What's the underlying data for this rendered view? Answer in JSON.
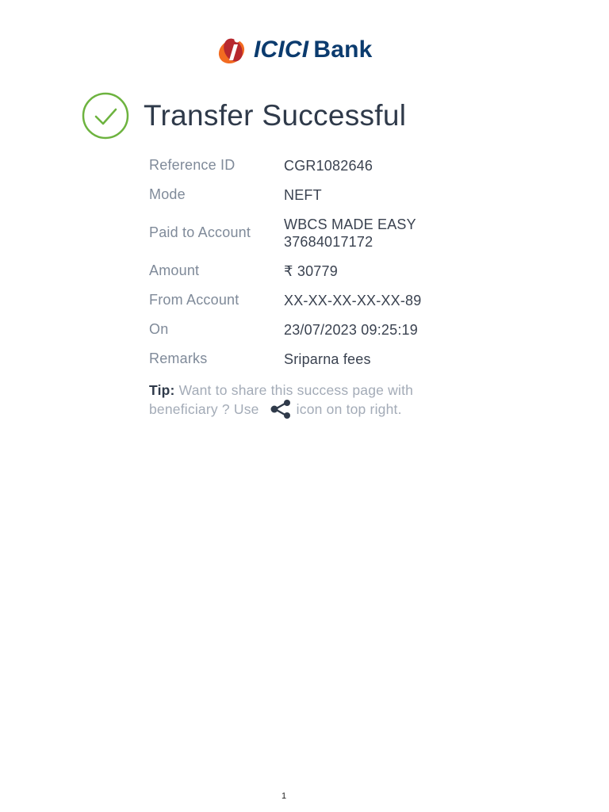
{
  "header": {
    "logo_brand": "ICICI",
    "logo_bank": "Bank"
  },
  "status": {
    "title": "Transfer Successful",
    "icon": "check-circle-icon",
    "success_color": "#6db33f"
  },
  "details": [
    {
      "label": "Reference ID",
      "value": [
        "CGR1082646"
      ]
    },
    {
      "label": "Mode",
      "value": [
        "NEFT"
      ]
    },
    {
      "label": "Paid to Account",
      "value": [
        "WBCS MADE EASY",
        "37684017172"
      ]
    },
    {
      "label": "Amount",
      "value": [
        "₹ 30779"
      ]
    },
    {
      "label": "From Account",
      "value": [
        "XX-XX-XX-XX-XX-89"
      ]
    },
    {
      "label": "On",
      "value": [
        "23/07/2023 09:25:19"
      ]
    },
    {
      "label": "Remarks",
      "value": [
        "Sriparna fees"
      ]
    }
  ],
  "tip": {
    "label": "Tip:",
    "text_before": " Want to share this success page with beneficiary ? Use",
    "icon": "share-icon",
    "text_after": "icon on top right."
  },
  "footer": {
    "page_number": "1"
  },
  "colors": {
    "brand_orange": "#f26b21",
    "brand_red": "#b7282e",
    "brand_navy": "#0b3b6e"
  }
}
